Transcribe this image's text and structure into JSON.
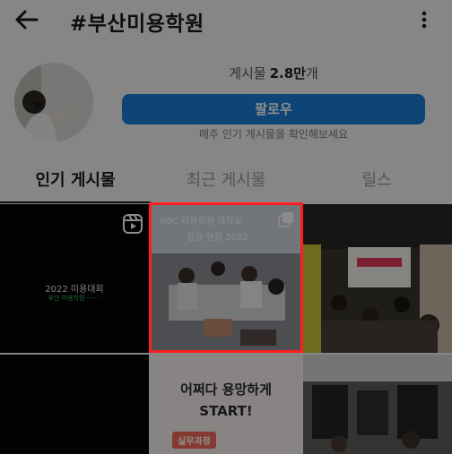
{
  "header": {
    "title": "#부산미용학원",
    "back_icon": "arrow-left-icon",
    "more_icon": "more-vertical-icon"
  },
  "profile": {
    "posts_label": "게시물",
    "posts_count": "2.8만",
    "posts_suffix": "개",
    "follow_label": "팔로우",
    "follow_subtext": "매주 인기 게시물을 확인해보세요"
  },
  "tabs": [
    {
      "label": "인기 게시물",
      "active": true
    },
    {
      "label": "최근 게시물",
      "active": false
    },
    {
      "label": "릴스",
      "active": false
    }
  ],
  "grid": {
    "cell1_text": "2022 미용대회",
    "cell1_subtext": "부산 미용학원 ·······",
    "cell2_banner_line1": "NBC 미용학원 대학교",
    "cell2_banner_line2": "실습 현장 2022",
    "cell5_text_line1": "어쩌다 용망하게",
    "cell5_text_line2": "START!",
    "cell5_badge": "실무과정",
    "reels_icon": "reels-icon",
    "multi_icon": "multi-post-icon"
  },
  "colors": {
    "follow_button": "#1d7fd8",
    "highlight": "#ff1d1d"
  }
}
